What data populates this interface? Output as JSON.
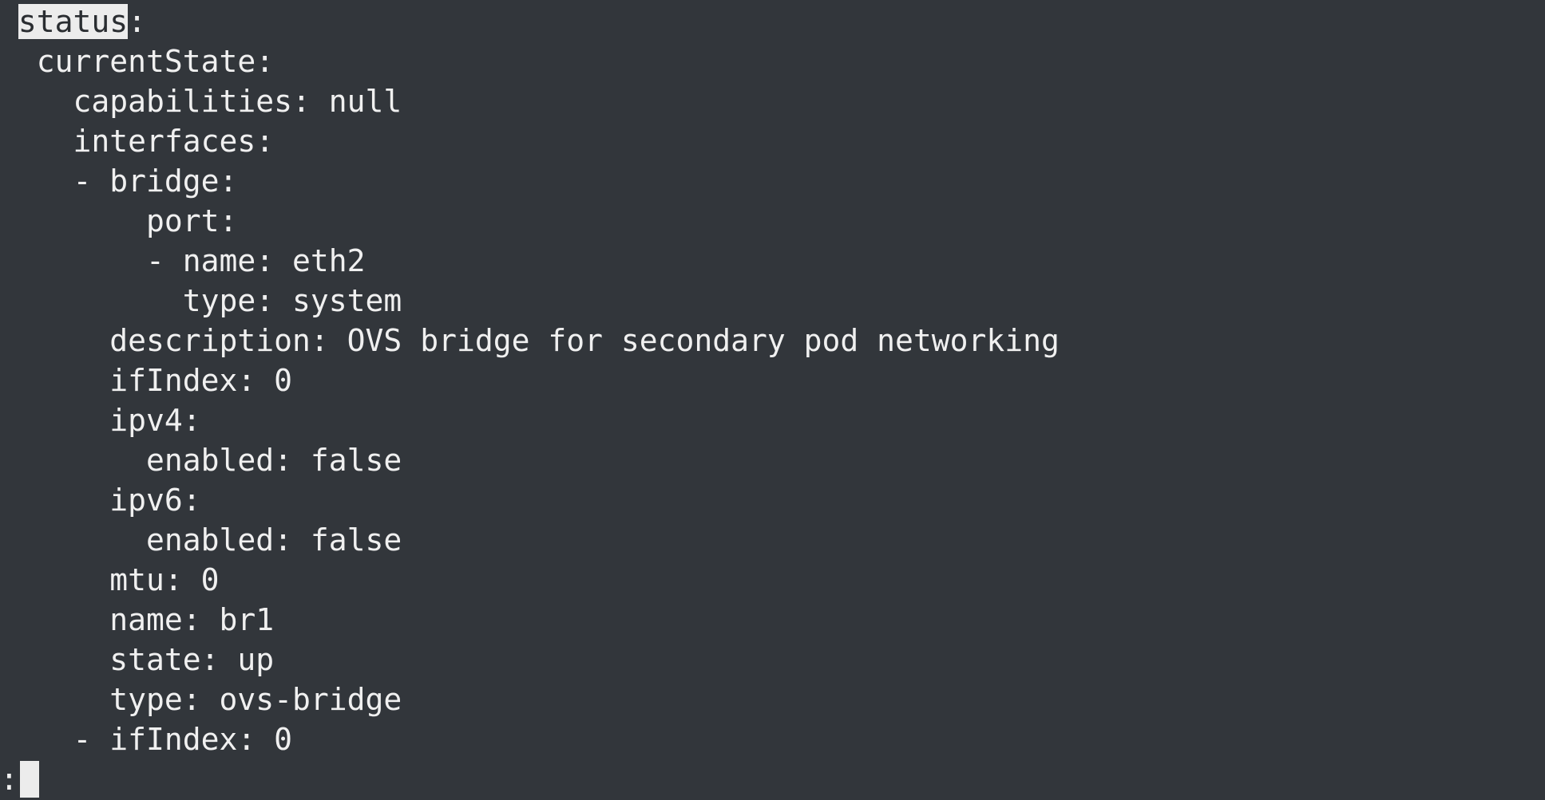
{
  "terminal": {
    "first_line": {
      "indent": " ",
      "highlighted": "status",
      "rest": ":"
    },
    "lines": [
      "  currentState:",
      "    capabilities: null",
      "    interfaces:",
      "    - bridge:",
      "        port:",
      "        - name: eth2",
      "          type: system",
      "      description: OVS bridge for secondary pod networking",
      "      ifIndex: 0",
      "      ipv4:",
      "        enabled: false",
      "      ipv6:",
      "        enabled: false",
      "      mtu: 0",
      "      name: br1",
      "      state: up",
      "      type: ovs-bridge",
      "    - ifIndex: 0"
    ],
    "prompt": ":"
  },
  "colors": {
    "background": "#32363b",
    "text": "#f0f0f0",
    "highlight": "#ececec"
  }
}
